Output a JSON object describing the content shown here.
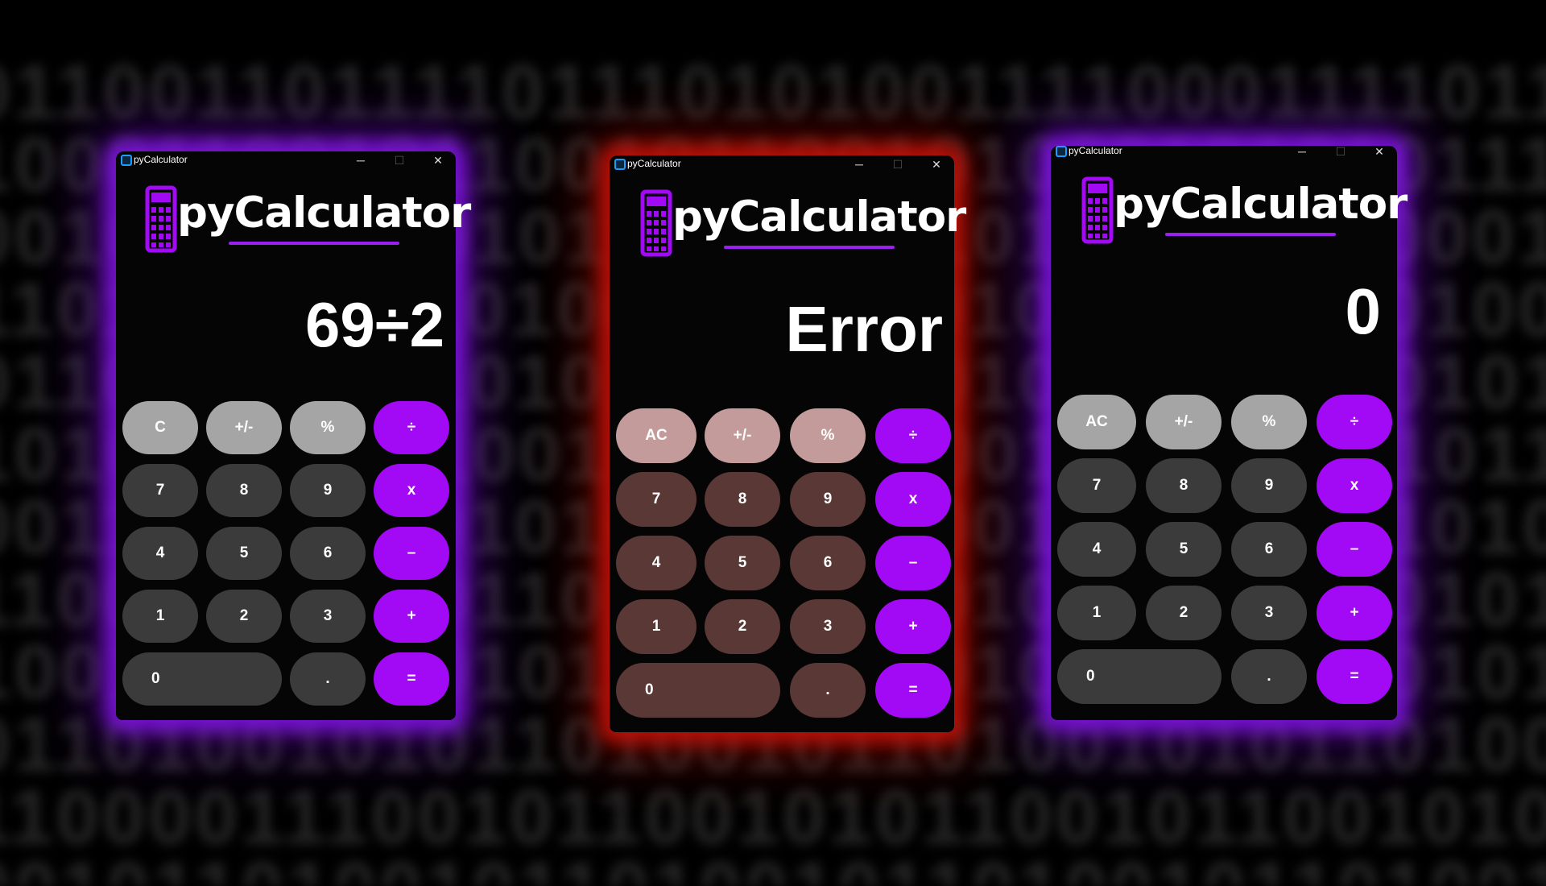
{
  "background_binary": [
    "01100110111101110101001111000111101110011",
    "10001100101100101100101000101010111101100",
    "00101100100101101011010101110010001011001",
    "11010100111010010101101010011010100101110",
    "01101010011010110101001010110010101001101",
    "10100101101001011010100101101001011010110",
    "00110101100101011010100110101001010110100",
    "11001010100110101001101010010110101001011",
    "10010110100101101011001011010010101101001",
    "01101001010110100101101001010110100101101",
    "11000011100101100101011001011001010110101",
    "00101101001011010010110100101101001011010"
  ],
  "colors": {
    "accent_purple": "#a209f4",
    "glow_purple": "#8214e6",
    "glow_red": "#c81208",
    "titlebar_icon": "#1e9bff"
  },
  "calculators": [
    {
      "window_title": "pyCalculator",
      "app_logo_text": "pyCalculator",
      "minimize": "─",
      "maximize": "☐",
      "close": "✕",
      "display": "69÷2",
      "rows": [
        [
          "C",
          "+/-",
          "%",
          "÷"
        ],
        [
          "7",
          "8",
          "9",
          "x"
        ],
        [
          "4",
          "5",
          "6",
          "–"
        ],
        [
          "1",
          "2",
          "3",
          "+"
        ],
        [
          "0",
          ".",
          "="
        ]
      ]
    },
    {
      "window_title": "pyCalculator",
      "app_logo_text": "pyCalculator",
      "minimize": "─",
      "maximize": "☐",
      "close": "✕",
      "display": "Error",
      "rows": [
        [
          "AC",
          "+/-",
          "%",
          "÷"
        ],
        [
          "7",
          "8",
          "9",
          "x"
        ],
        [
          "4",
          "5",
          "6",
          "–"
        ],
        [
          "1",
          "2",
          "3",
          "+"
        ],
        [
          "0",
          ".",
          "="
        ]
      ]
    },
    {
      "window_title": "pyCalculator",
      "app_logo_text": "pyCalculator",
      "minimize": "─",
      "maximize": "☐",
      "close": "✕",
      "display": "0",
      "rows": [
        [
          "AC",
          "+/-",
          "%",
          "÷"
        ],
        [
          "7",
          "8",
          "9",
          "x"
        ],
        [
          "4",
          "5",
          "6",
          "–"
        ],
        [
          "1",
          "2",
          "3",
          "+"
        ],
        [
          "0",
          ".",
          "="
        ]
      ]
    }
  ]
}
